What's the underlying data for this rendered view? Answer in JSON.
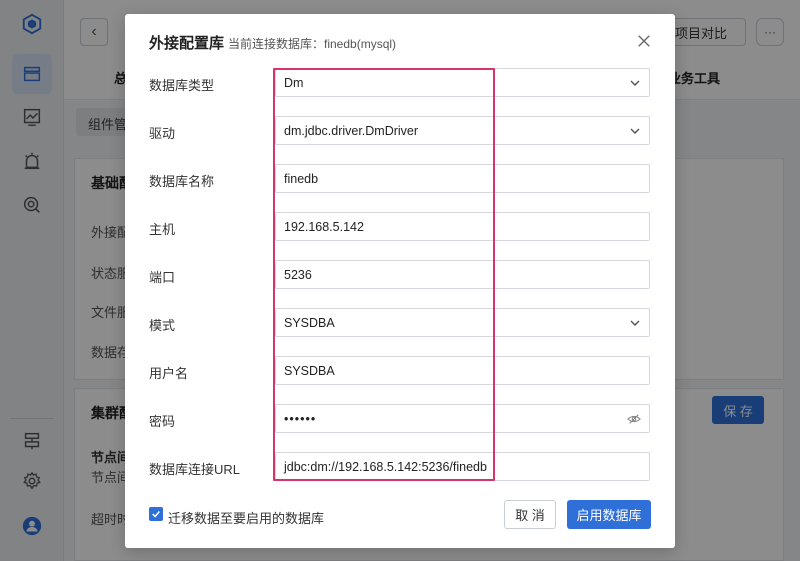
{
  "background": {
    "compare_label": "项目对比",
    "more_label": "···",
    "top_tab_left": "总",
    "top_tab_right": "业务工具",
    "subtab_label": "组件管",
    "card1_title": "基础配",
    "card1_rows": [
      "外接配",
      "状态服",
      "文件服",
      "数据存"
    ],
    "card2_title": "集群配",
    "card2_rows": [
      "节点间",
      "节点间",
      "超时时"
    ],
    "save_label": "保 存"
  },
  "dialog": {
    "title": "外接配置库",
    "subtitle": "当前连接数据库：finedb(mysql)",
    "fields": [
      {
        "label": "数据库类型",
        "value": "Dm",
        "kind": "select"
      },
      {
        "label": "驱动",
        "value": "dm.jdbc.driver.DmDriver",
        "kind": "select"
      },
      {
        "label": "数据库名称",
        "value": "finedb",
        "kind": "input"
      },
      {
        "label": "主机",
        "value": "192.168.5.142",
        "kind": "input"
      },
      {
        "label": "端口",
        "value": "5236",
        "kind": "input"
      },
      {
        "label": "模式",
        "value": "SYSDBA",
        "kind": "select"
      },
      {
        "label": "用户名",
        "value": "SYSDBA",
        "kind": "input"
      },
      {
        "label": "密码",
        "value": "••••••",
        "kind": "password"
      },
      {
        "label": "数据库连接URL",
        "value": "jdbc:dm://192.168.5.142:5236/finedb",
        "kind": "input"
      }
    ],
    "migrate_label": "迁移数据至要启用的数据库",
    "migrate_checked": true,
    "cancel_label": "取 消",
    "confirm_label": "启用数据库"
  },
  "colors": {
    "primary": "#2f6fd8",
    "highlight": "#d8336a"
  }
}
